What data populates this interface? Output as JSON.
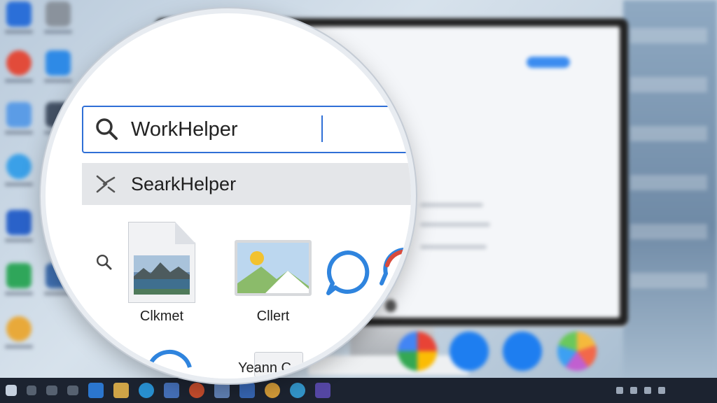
{
  "search": {
    "value": "WorkHelper",
    "placeholder": ""
  },
  "suggestion": {
    "label": "SearkHelper"
  },
  "results": [
    {
      "name": "Clkmet",
      "icon": "image-document-icon"
    },
    {
      "name": "Cllert",
      "icon": "picture-icon"
    }
  ],
  "partial_label": "Yeann C",
  "colors": {
    "accent": "#2f6fd6",
    "search_button": "#a9c7ee",
    "suggestion_row": "#e4e6e9",
    "taskbar": "#1c2330"
  }
}
